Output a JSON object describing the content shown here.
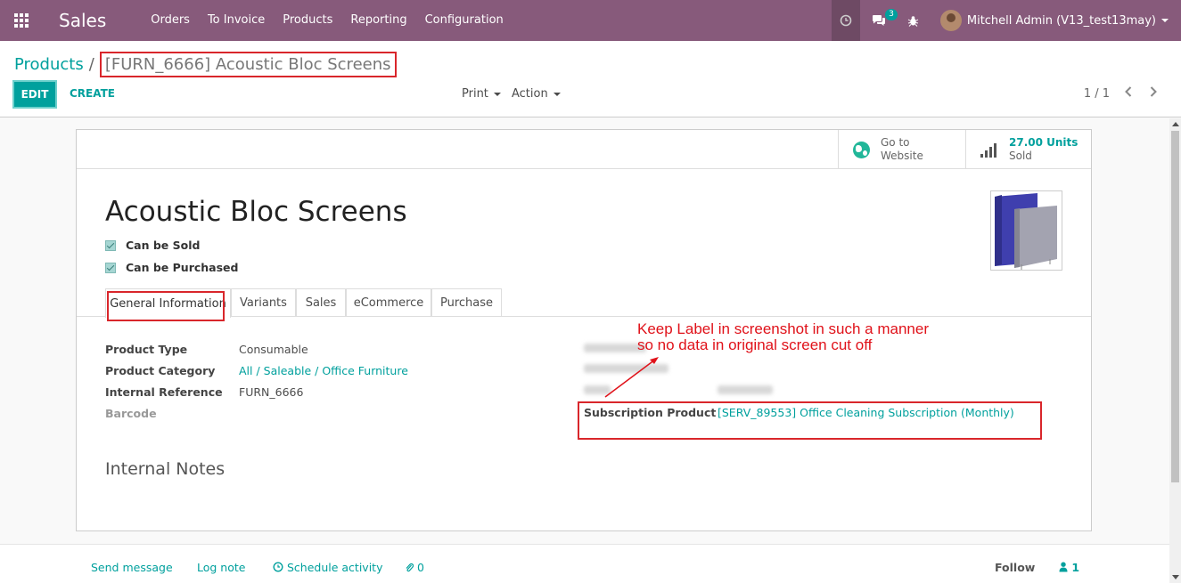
{
  "navbar": {
    "app_name": "Sales",
    "menu": [
      "Orders",
      "To Invoice",
      "Products",
      "Reporting",
      "Configuration"
    ],
    "messages_count": "3",
    "user_name": "Mitchell Admin (V13_test13may)"
  },
  "breadcrumb": {
    "parent": "Products",
    "separator": "/",
    "current": "[FURN_6666] Acoustic Bloc Screens"
  },
  "toolbar": {
    "edit_label": "EDIT",
    "create_label": "CREATE",
    "print_label": "Print",
    "action_label": "Action",
    "pager": "1 / 1"
  },
  "smart_buttons": {
    "website_line1": "Go to",
    "website_line2": "Website",
    "sold_value": "27.00 Units",
    "sold_label": "Sold"
  },
  "product": {
    "name": "Acoustic Bloc Screens",
    "can_be_sold": "Can be Sold",
    "can_be_purchased": "Can be Purchased"
  },
  "tabs": [
    "General Information",
    "Variants",
    "Sales",
    "eCommerce",
    "Purchase"
  ],
  "general_info": {
    "product_type_label": "Product Type",
    "product_type": "Consumable",
    "category_label": "Product Category",
    "category": "All / Saleable / Office Furniture",
    "internal_ref_label": "Internal Reference",
    "internal_ref": "FURN_6666",
    "barcode_label": "Barcode",
    "subscription_label": "Subscription Product",
    "subscription_value": "[SERV_89553] Office Cleaning Subscription (Monthly)",
    "internal_notes_title": "Internal Notes"
  },
  "annotation": {
    "line1": "Keep Label in screenshot in such a manner",
    "line2": "so no data in original screen cut off"
  },
  "chatter": {
    "send_message": "Send message",
    "log_note": "Log note",
    "schedule_activity": "Schedule activity",
    "attachments": "0",
    "follow": "Follow",
    "followers": "1"
  },
  "colors": {
    "navbar": "#875a7b",
    "accent": "#00a09d",
    "annotation": "#e0121a"
  }
}
